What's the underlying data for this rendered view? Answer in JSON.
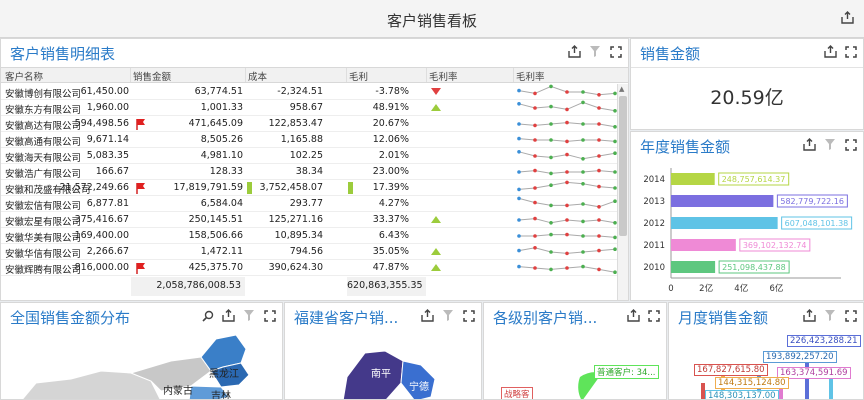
{
  "page": {
    "title": "客户销售看板"
  },
  "detail": {
    "title": "客户销售明细表",
    "columns": [
      "客户名称",
      "销售金额",
      "成本",
      "毛利",
      "毛利率",
      "毛利率"
    ],
    "rows": [
      {
        "name": "安徽博创有限公司",
        "sales": "61,450.00",
        "cost": "63,774.51",
        "profit": "-2,324.51",
        "rate": "-3.78%",
        "flag": false,
        "bar": false,
        "tri": "down"
      },
      {
        "name": "安徽东方有限公司",
        "sales": "1,960.00",
        "cost": "1,001.33",
        "profit": "958.67",
        "rate": "48.91%",
        "flag": false,
        "bar": false,
        "tri": "up"
      },
      {
        "name": "安徽高达有限公司",
        "sales": "594,498.56",
        "cost": "471,645.09",
        "profit": "122,853.47",
        "rate": "20.67%",
        "flag": true,
        "bar": false,
        "tri": "none"
      },
      {
        "name": "安徽高通有限公司",
        "sales": "9,671.14",
        "cost": "8,505.26",
        "profit": "1,165.88",
        "rate": "12.06%",
        "flag": false,
        "bar": false,
        "tri": "none"
      },
      {
        "name": "安徽海天有限公司",
        "sales": "5,083.35",
        "cost": "4,981.10",
        "profit": "102.25",
        "rate": "2.01%",
        "flag": false,
        "bar": false,
        "tri": "none"
      },
      {
        "name": "安徽浩广有限公司",
        "sales": "166.67",
        "cost": "128.33",
        "profit": "38.34",
        "rate": "23.00%",
        "flag": false,
        "bar": false,
        "tri": "none"
      },
      {
        "name": "安徽和茂盛有限公司",
        "sales": "21,572,249.66",
        "cost": "17,819,791.59",
        "profit": "3,752,458.07",
        "rate": "17.39%",
        "flag": true,
        "bar": true,
        "tri": "none"
      },
      {
        "name": "安徽宏信有限公司",
        "sales": "6,877.81",
        "cost": "6,584.04",
        "profit": "293.77",
        "rate": "4.27%",
        "flag": false,
        "bar": false,
        "tri": "none"
      },
      {
        "name": "安徽宏星有限公司",
        "sales": "375,416.67",
        "cost": "250,145.51",
        "profit": "125,271.16",
        "rate": "33.37%",
        "flag": false,
        "bar": false,
        "tri": "up"
      },
      {
        "name": "安徽华美有限公司",
        "sales": "169,400.00",
        "cost": "158,506.66",
        "profit": "10,895.34",
        "rate": "6.43%",
        "flag": false,
        "bar": false,
        "tri": "none"
      },
      {
        "name": "安徽华信有限公司",
        "sales": "2,266.67",
        "cost": "1,472.11",
        "profit": "794.56",
        "rate": "35.05%",
        "flag": false,
        "bar": false,
        "tri": "up"
      },
      {
        "name": "安徽辉腾有限公司",
        "sales": "816,000.00",
        "cost": "425,375.70",
        "profit": "390,624.30",
        "rate": "47.87%",
        "flag": true,
        "bar": false,
        "tri": "up"
      }
    ],
    "totals": {
      "sales": "2,058,786,008.53",
      "profit": "620,863,355.35"
    }
  },
  "kpi": {
    "title": "销售金额",
    "value": "20.59亿"
  },
  "annual": {
    "title": "年度销售金额",
    "ticks": [
      "0",
      "2亿",
      "4亿",
      "6亿"
    ]
  },
  "national": {
    "title": "全国销售金额分布",
    "labels": [
      "黑龙江",
      "内蒙古",
      "吉林"
    ]
  },
  "fujian": {
    "title": "福建省客户销...",
    "labels": [
      "南平",
      "宁德"
    ]
  },
  "level": {
    "title": "各级别客户销...",
    "labels": [
      "普通客户: 34...",
      "战略客"
    ]
  },
  "monthly": {
    "title": "月度销售金额",
    "labels": [
      "226,423,288.21",
      "193,892,257.20",
      "167,827,615.80",
      "163,374,591.69",
      "144,315,124.80",
      "148,303,137.00"
    ]
  },
  "colors": {
    "accent": "#2a7bc8",
    "up": "#9ccc3c",
    "down": "#e04040",
    "bar2014": "#b5d645",
    "bar2013": "#7b6fe0",
    "bar2012": "#5fc3e6",
    "bar2011": "#ef8ad6",
    "bar2010": "#5ec77f"
  },
  "chart_data": [
    {
      "type": "bar",
      "orientation": "horizontal",
      "categories": [
        "2014",
        "2013",
        "2012",
        "2011",
        "2010"
      ],
      "values": [
        248757614.37,
        582779722.16,
        607048101.38,
        369102132.74,
        251098437.88
      ],
      "labels": [
        "248,757,614.37",
        "582,779,722.16",
        "607,048,101.38",
        "369,102,132.74",
        "251,098,437.88"
      ],
      "xlim": [
        0,
        600000000
      ],
      "xticks": [
        "0",
        "2亿",
        "4亿",
        "6亿"
      ],
      "grid": false
    }
  ]
}
